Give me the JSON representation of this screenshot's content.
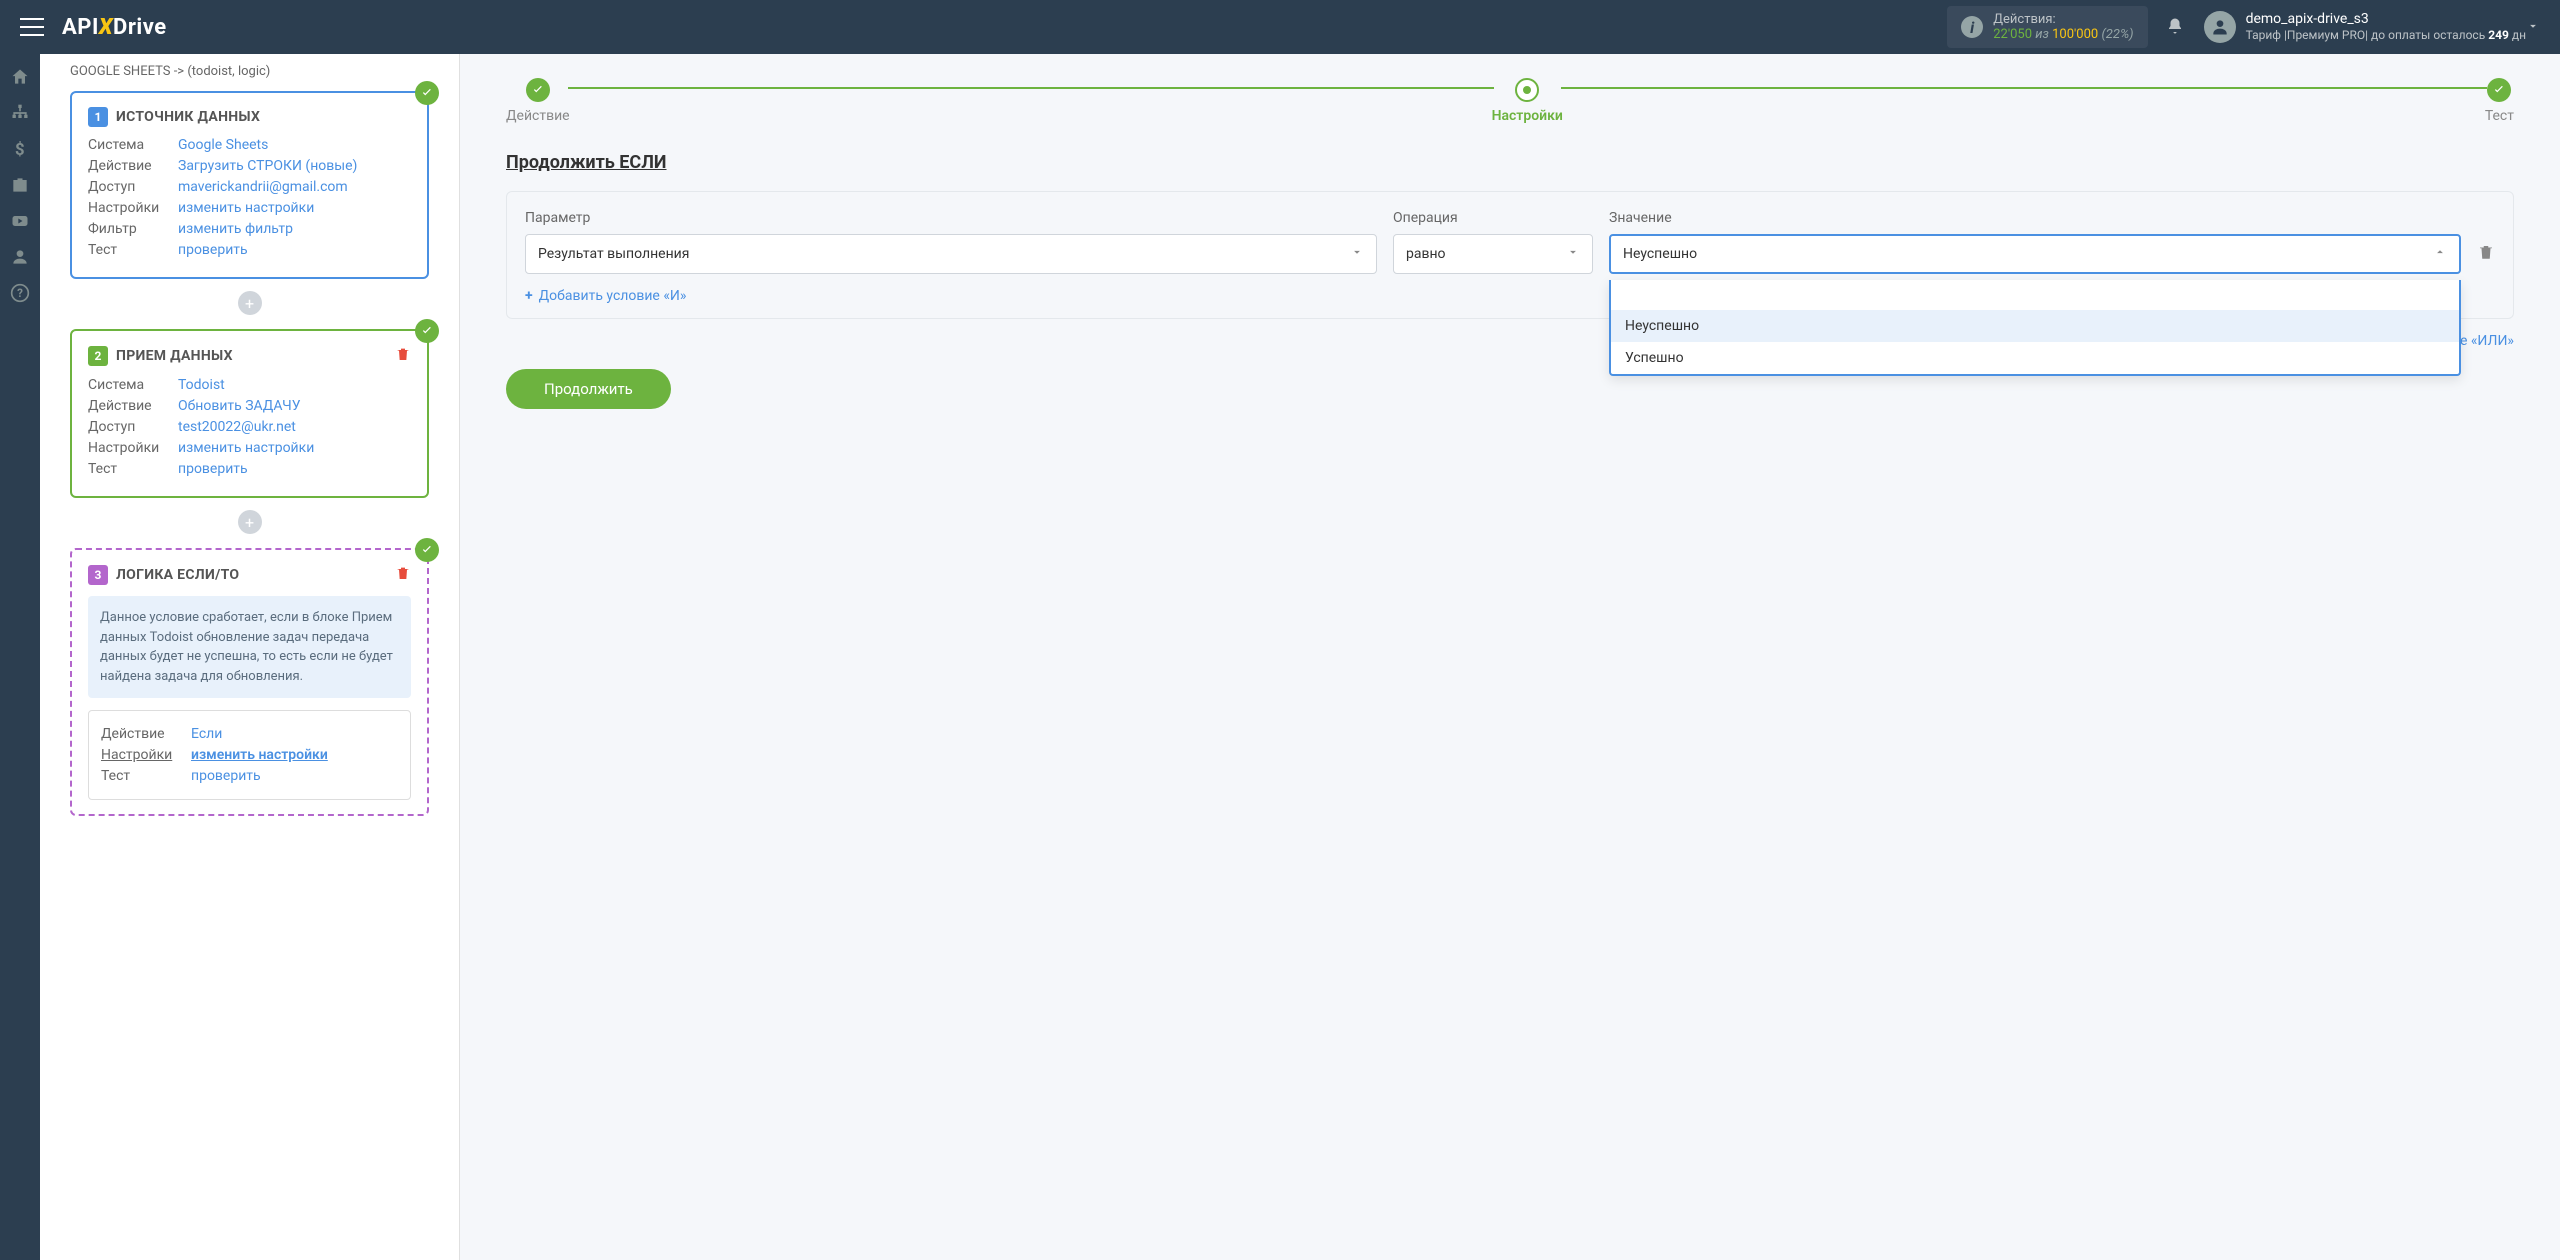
{
  "header": {
    "logo_pre": "API",
    "logo_x": "X",
    "logo_post": "Drive",
    "actions_label": "Действия:",
    "actions_current": "22'050",
    "actions_of": " из ",
    "actions_total": "100'000",
    "actions_pct": "(22%)",
    "user_name": "demo_apix-drive_s3",
    "user_plan_pre": "Тариф |Премиум PRO| до оплаты осталось ",
    "user_days": "249",
    "user_plan_post": " дн"
  },
  "sidebar": {
    "breadcrumb": "GOOGLE SHEETS -> (todoist, logic)",
    "block1": {
      "num": "1",
      "title": "ИСТОЧНИК ДАННЫХ",
      "rows": {
        "system_k": "Система",
        "system_v": "Google Sheets",
        "action_k": "Действие",
        "action_v": "Загрузить СТРОКИ (новые)",
        "access_k": "Доступ",
        "access_v": "maverickandrii@gmail.com",
        "settings_k": "Настройки",
        "settings_v": "изменить настройки",
        "filter_k": "Фильтр",
        "filter_v": "изменить фильтр",
        "test_k": "Тест",
        "test_v": "проверить"
      }
    },
    "block2": {
      "num": "2",
      "title": "ПРИЕМ ДАННЫХ",
      "rows": {
        "system_k": "Система",
        "system_v": "Todoist",
        "action_k": "Действие",
        "action_v": "Обновить ЗАДАЧУ",
        "access_k": "Доступ",
        "access_v": "test20022@ukr.net",
        "settings_k": "Настройки",
        "settings_v": "изменить настройки",
        "test_k": "Тест",
        "test_v": "проверить"
      }
    },
    "block3": {
      "num": "3",
      "title": "ЛОГИКА ЕСЛИ/ТО",
      "note": "Данное условие сработает, если в блоке Прием данных Todoist обновление задач передача данных будет не успешна, то есть если не будет найдена задача для обновления.",
      "rows": {
        "action_k": "Действие",
        "action_v": "Если",
        "settings_k": "Настройки",
        "settings_v": "изменить настройки",
        "test_k": "Тест",
        "test_v": "проверить"
      }
    }
  },
  "main": {
    "steps": {
      "s1": "Действие",
      "s2": "Настройки",
      "s3": "Тест"
    },
    "section_title": "Продолжить ЕСЛИ",
    "labels": {
      "param": "Параметр",
      "op": "Операция",
      "val": "Значение"
    },
    "selects": {
      "param": "Результат выполнения",
      "op": "равно",
      "val": "Неуспешно"
    },
    "dropdown": {
      "opt1": "Неуспешно",
      "opt2": "Успешно"
    },
    "add_and": "Добавить условие «И»",
    "add_or": "+ Добавить условие «ИЛИ»",
    "continue": "Продолжить"
  }
}
